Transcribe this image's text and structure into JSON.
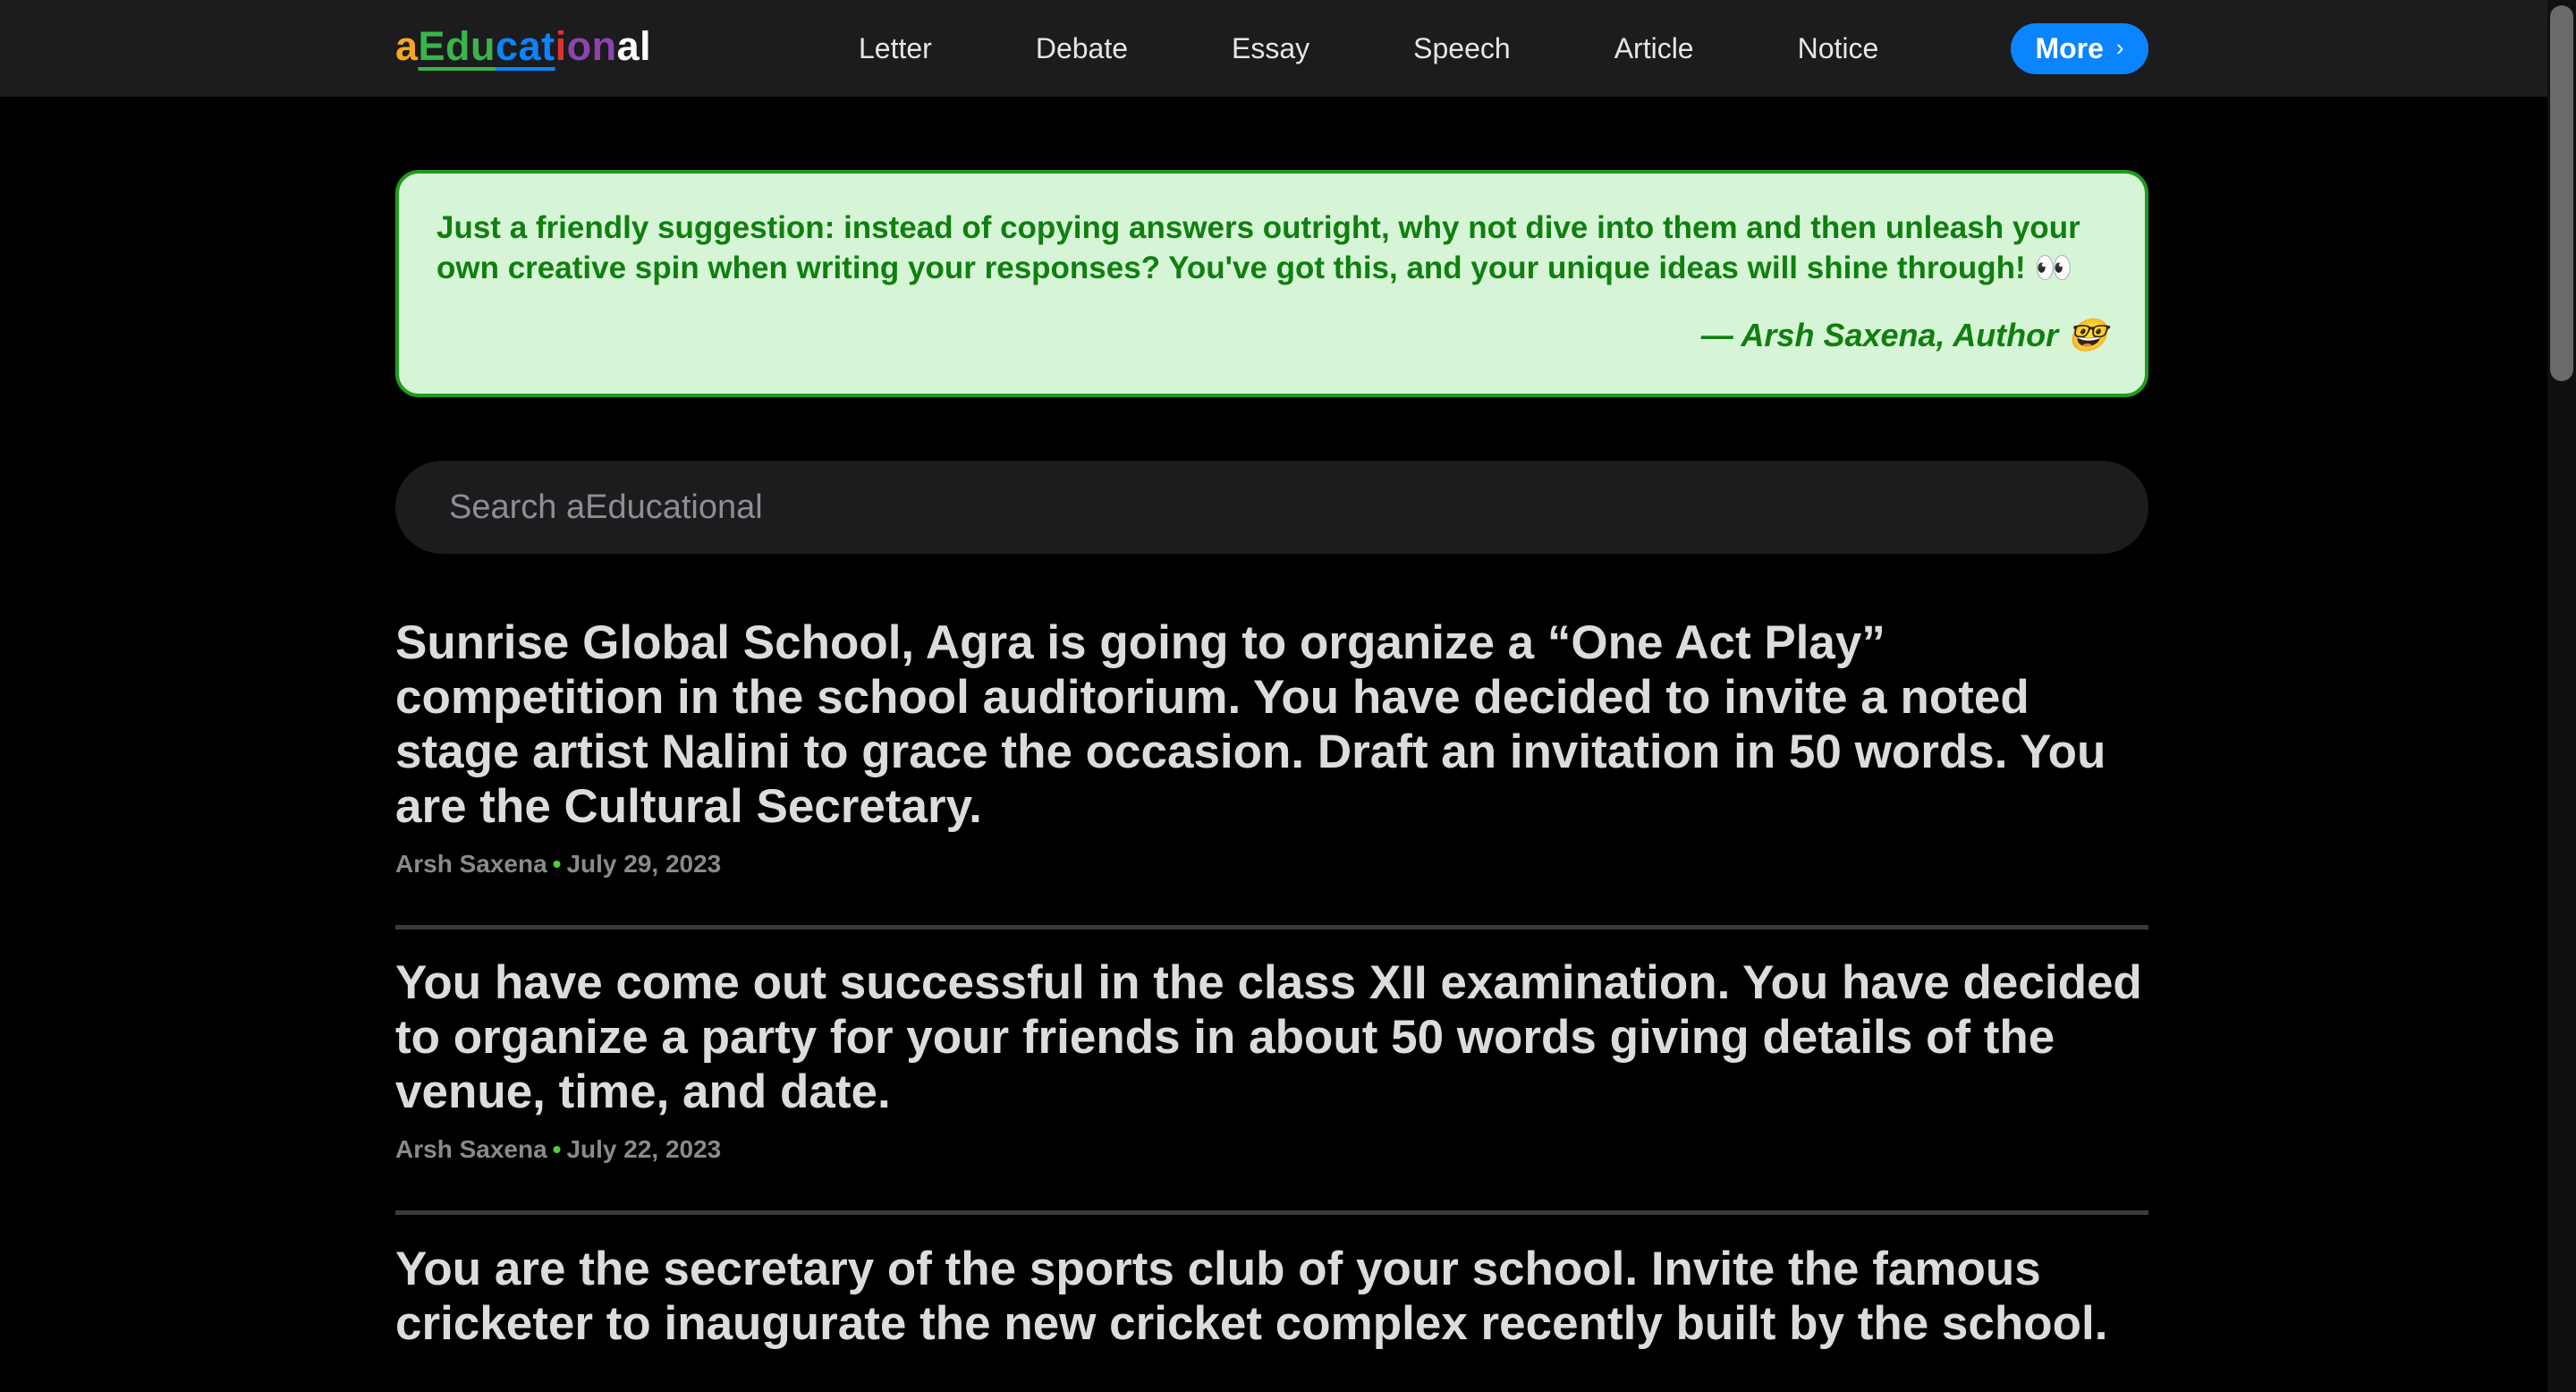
{
  "header": {
    "logo_letters": [
      {
        "ch": "a",
        "color": "#f5a623",
        "underline": false
      },
      {
        "ch": "E",
        "color": "#39b54a",
        "underline": true
      },
      {
        "ch": "d",
        "color": "#39b54a",
        "underline": true
      },
      {
        "ch": "u",
        "color": "#39b54a",
        "underline": true
      },
      {
        "ch": "c",
        "color": "#0a84ff",
        "underline": true
      },
      {
        "ch": "a",
        "color": "#0a84ff",
        "underline": true
      },
      {
        "ch": "t",
        "color": "#0a84ff",
        "underline": true
      },
      {
        "ch": "i",
        "color": "#e03131",
        "underline": false
      },
      {
        "ch": "o",
        "color": "#8e44ad",
        "underline": false
      },
      {
        "ch": "n",
        "color": "#8e44ad",
        "underline": false
      },
      {
        "ch": "a",
        "color": "#ffffff",
        "underline": false
      },
      {
        "ch": "l",
        "color": "#ffffff",
        "underline": false
      }
    ],
    "nav": {
      "letter": "Letter",
      "debate": "Debate",
      "essay": "Essay",
      "speech": "Speech",
      "article": "Article",
      "notice": "Notice"
    },
    "more_label": "More",
    "more_icon": "chevron-right-icon"
  },
  "note": {
    "text": "Just a friendly suggestion: instead of copying answers outright, why not dive into them and then unleash your own creative spin when writing your responses? You've got this, and your unique ideas will shine through! 👀",
    "author": "— Arsh Saxena, Author 🤓"
  },
  "search": {
    "placeholder": "Search aEducational",
    "value": ""
  },
  "articles": [
    {
      "title": "Sunrise Global School, Agra is going to organize a “One Act Play” competition in the school auditorium. You have decided to invite a noted stage artist Nalini to grace the occasion. Draft an invitation in 50 words. You are the Cultural Secretary.",
      "author": "Arsh Saxena",
      "date": "July 29, 2023"
    },
    {
      "title": "You have come out successful in the class XII examination. You have decided to organize a party for your friends in about 50 words giving details of the venue, time, and date.",
      "author": "Arsh Saxena",
      "date": "July 22, 2023"
    },
    {
      "title": "You are the secretary of the sports club of your school. Invite the famous cricketer to inaugurate the new cricket complex recently built by the school."
    }
  ],
  "colors": {
    "accent": "#0a84ff",
    "note_bg": "#d6f5d6",
    "note_border": "#1f9c1f",
    "note_text": "#0f7f0f",
    "meta_dot": "#4cd137"
  }
}
